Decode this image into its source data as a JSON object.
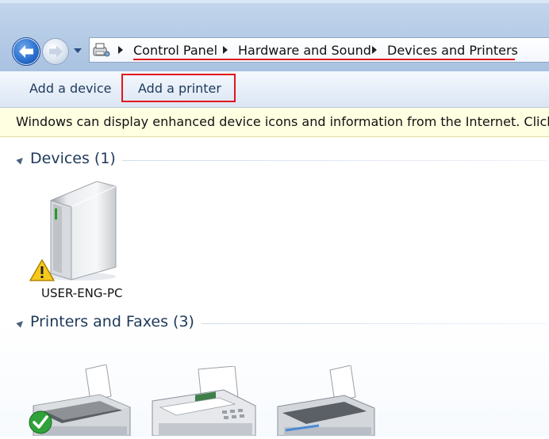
{
  "navigation": {
    "back_icon": "back-arrow-icon",
    "forward_icon": "forward-arrow-icon",
    "recent_icon": "chevron-down-icon"
  },
  "address_bar": {
    "location_icon": "devices-printers-folder-icon",
    "breadcrumbs": [
      "Control Panel",
      "Hardware and Sound",
      "Devices and Printers"
    ],
    "separator_icon": "breadcrumb-arrow-icon"
  },
  "toolbar": {
    "add_device": "Add a device",
    "add_printer": "Add a printer"
  },
  "info_bar": {
    "message": "Windows can display enhanced device icons and information from the Internet. Click to change..."
  },
  "groups": [
    {
      "title": "Devices (1)",
      "items": [
        {
          "label": "USER-ENG-PC",
          "icon": "computer-tower-icon",
          "overlay": "warning-icon"
        }
      ]
    },
    {
      "title": "Printers and Faxes (3)",
      "items": [
        {
          "label": "",
          "icon": "printer-icon",
          "overlay": "default-checkmark-icon"
        },
        {
          "label": "",
          "icon": "fax-icon"
        },
        {
          "label": "",
          "icon": "printer-icon"
        }
      ]
    }
  ],
  "colors": {
    "highlight_red": "#e2161c",
    "group_title": "#1e395b",
    "infobar_bg": "#ffffe1"
  }
}
